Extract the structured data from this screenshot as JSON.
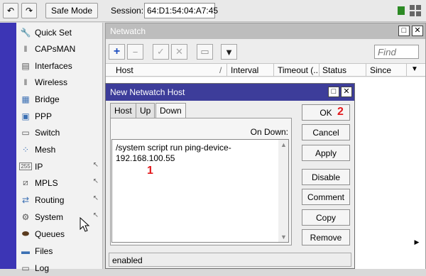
{
  "toolbar": {
    "undo_icon": "undo-icon",
    "redo_icon": "redo-icon",
    "safe_mode_label": "Safe Mode",
    "session_label": "Session:",
    "session_value": "64:D1:54:04:A7:45"
  },
  "sidebar": {
    "items": [
      {
        "label": "Quick Set",
        "icon": "wrench-icon",
        "submenu": false
      },
      {
        "label": "CAPsMAN",
        "icon": "antenna-icon",
        "submenu": false
      },
      {
        "label": "Interfaces",
        "icon": "ports-icon",
        "submenu": false
      },
      {
        "label": "Wireless",
        "icon": "wireless-icon",
        "submenu": false
      },
      {
        "label": "Bridge",
        "icon": "bridge-icon",
        "submenu": false
      },
      {
        "label": "PPP",
        "icon": "ppp-icon",
        "submenu": false
      },
      {
        "label": "Switch",
        "icon": "switch-icon",
        "submenu": false
      },
      {
        "label": "Mesh",
        "icon": "mesh-icon",
        "submenu": false
      },
      {
        "label": "IP",
        "icon": "ip-icon",
        "submenu": true
      },
      {
        "label": "MPLS",
        "icon": "mpls-icon",
        "submenu": true
      },
      {
        "label": "Routing",
        "icon": "routing-icon",
        "submenu": true
      },
      {
        "label": "System",
        "icon": "gear-icon",
        "submenu": true
      },
      {
        "label": "Queues",
        "icon": "queues-icon",
        "submenu": false
      },
      {
        "label": "Files",
        "icon": "folder-icon",
        "submenu": false
      },
      {
        "label": "Log",
        "icon": "log-icon",
        "submenu": false
      }
    ]
  },
  "netwatch": {
    "title": "Netwatch",
    "find_placeholder": "Find",
    "columns": [
      "Host",
      "Interval",
      "Timeout (...",
      "Status",
      "Since"
    ]
  },
  "dialog": {
    "title": "New Netwatch Host",
    "tabs": [
      "Host",
      "Up",
      "Down"
    ],
    "active_tab": "Down",
    "on_down_label": "On Down:",
    "script": "/system script run ping-device-\n192.168.100.55",
    "status": "enabled",
    "buttons": {
      "ok": "OK",
      "cancel": "Cancel",
      "apply": "Apply",
      "disable": "Disable",
      "comment": "Comment",
      "copy": "Copy",
      "remove": "Remove"
    },
    "callouts": {
      "one": "1",
      "two": "2"
    }
  },
  "colors": {
    "accent_strip": "#3c35b5",
    "dialog_title": "#3d3d9a",
    "callout": "#e3191c"
  }
}
